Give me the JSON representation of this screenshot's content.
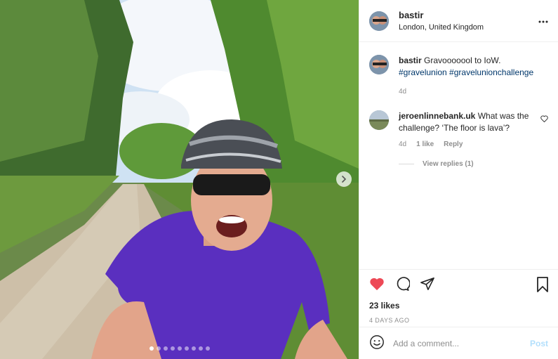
{
  "header": {
    "username": "bastir",
    "location": "London, United Kingdom",
    "more_icon": "more-horizontal-icon"
  },
  "media": {
    "slide_count": 9,
    "active_slide": 1,
    "next_icon": "chevron-right-icon"
  },
  "caption": {
    "username": "bastir",
    "text": "Gravooooool to IoW.",
    "hashtags": "#gravelunion #gravelunionchallenge",
    "time": "4d"
  },
  "comments": [
    {
      "username": "jeroenlinnebank.uk",
      "text": "What was the challenge? ‘The floor is lava’?",
      "time": "4d",
      "likes": "1 like",
      "reply": "Reply",
      "view_replies": "View replies (1)"
    }
  ],
  "actions": {
    "liked": true,
    "like_color": "#ed4956",
    "likes": "23 likes",
    "date": "4 DAYS AGO"
  },
  "add_comment": {
    "placeholder": "Add a comment...",
    "post_label": "Post",
    "post_color": "#b2dffc"
  }
}
